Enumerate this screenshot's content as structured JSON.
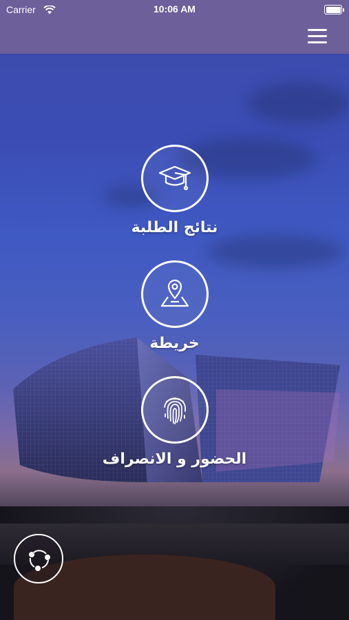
{
  "status_bar": {
    "carrier": "Carrier",
    "time": "10:06 AM",
    "wifi_icon": "wifi-icon",
    "battery_icon": "battery-icon"
  },
  "navbar": {
    "menu_icon": "hamburger-menu-icon",
    "color": "#6c5f9a"
  },
  "features": [
    {
      "label": "نتائج الطلبة",
      "icon": "graduation-cap-icon"
    },
    {
      "label": "خريطة",
      "icon": "map-pin-icon"
    },
    {
      "label": "الحضور و الانصراف",
      "icon": "fingerprint-icon"
    }
  ],
  "share_button": {
    "icon": "share-icon"
  },
  "colors": {
    "accent": "#6c5f9a",
    "icon_stroke": "#ffffff"
  }
}
